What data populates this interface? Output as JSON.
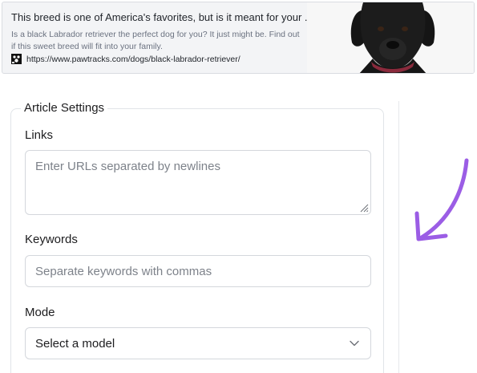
{
  "preview": {
    "title": "This breed is one of America's favorites, but is it meant for your ...",
    "description": "Is a black Labrador retriever the perfect dog for you? It just might be. Find out if this sweet breed will fit into your family.",
    "url": "https://www.pawtracks.com/dogs/black-labrador-retriever/",
    "favicon_icon": "pawtracks-favicon-icon",
    "image_subject": "black-labrador-photo"
  },
  "settings": {
    "legend": "Article Settings",
    "links": {
      "label": "Links",
      "placeholder": "Enter URLs separated by newlines"
    },
    "keywords": {
      "label": "Keywords",
      "placeholder": "Separate keywords with commas"
    },
    "mode": {
      "label": "Mode",
      "selected": "Select a model"
    }
  },
  "colors": {
    "arrow": "#9b5de5",
    "border": "#e1e4e8",
    "card_bg": "#f3f4f6"
  }
}
